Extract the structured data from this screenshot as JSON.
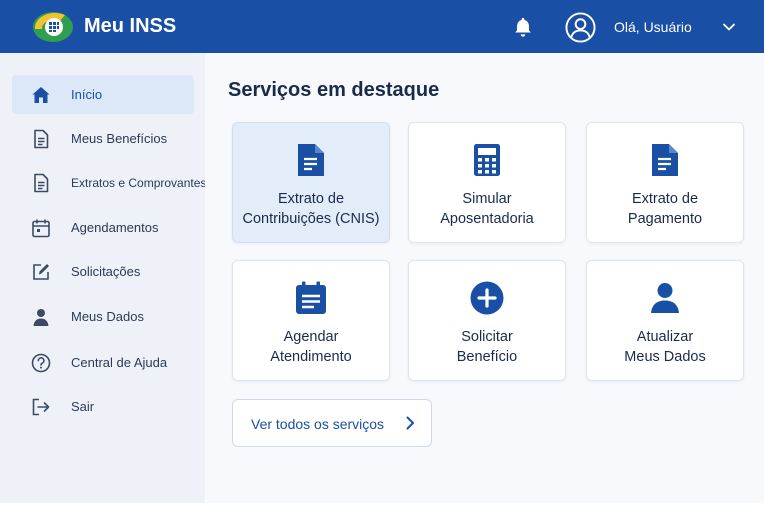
{
  "header": {
    "app_title": "Meu INSS",
    "greeting": "Olá, Usuário",
    "brand_color": "#1a4fa6"
  },
  "sidebar": {
    "items": [
      {
        "label": "Início",
        "icon": "home-icon",
        "active": true
      },
      {
        "label": "Meus Benefícios",
        "icon": "document-icon",
        "active": false
      },
      {
        "label": "Extratos e Comprovantes",
        "icon": "document-icon",
        "active": false
      },
      {
        "label": "Agendamentos",
        "icon": "calendar-icon",
        "active": false
      },
      {
        "label": "Solicitações",
        "icon": "edit-icon",
        "active": false
      },
      {
        "label": "Meus Dados",
        "icon": "user-icon",
        "active": false
      },
      {
        "label": "Central de Ajuda",
        "icon": "help-icon",
        "active": false
      },
      {
        "label": "Sair",
        "icon": "logout-icon",
        "active": false
      }
    ]
  },
  "main": {
    "section_title": "Serviços em destaque",
    "cards": [
      {
        "line1": "Extrato de",
        "line2": "Contribuições (CNIS)",
        "icon": "document-icon",
        "highlighted": true
      },
      {
        "line1": "Simular",
        "line2": "Aposentadoria",
        "icon": "calculator-icon",
        "highlighted": false
      },
      {
        "line1": "Extrato de",
        "line2": "Pagamento",
        "icon": "document-icon",
        "highlighted": false
      },
      {
        "line1": "Agendar",
        "line2": "Atendimento",
        "icon": "calendar-icon",
        "highlighted": false
      },
      {
        "line1": "Solicitar",
        "line2": "Benefício",
        "icon": "plus-circle-icon",
        "highlighted": false
      },
      {
        "line1": "Atualizar",
        "line2": "Meus Dados",
        "icon": "user-icon",
        "highlighted": false
      }
    ],
    "view_all_label": "Ver todos os serviços"
  }
}
